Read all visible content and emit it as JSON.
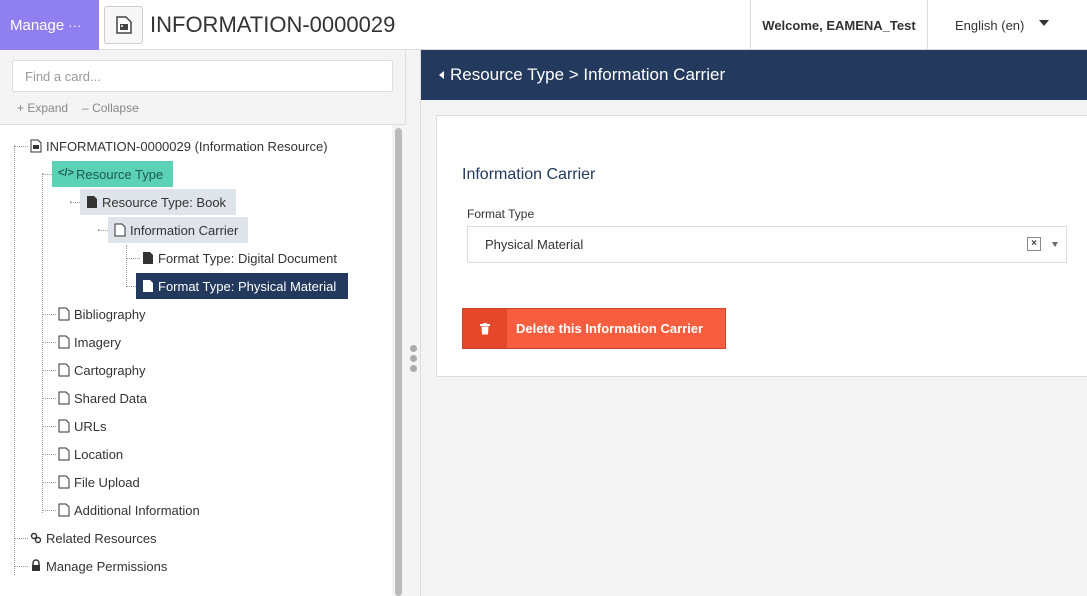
{
  "topbar": {
    "manage_label": "Manage",
    "manage_dots": "···",
    "resource_title": "INFORMATION-0000029",
    "welcome": "Welcome, EAMENA_Test",
    "language": "English (en)"
  },
  "left": {
    "search_placeholder": "Find a card...",
    "expand_label": "Expand",
    "collapse_label": "Collapse"
  },
  "tree": {
    "root": "INFORMATION-0000029 (Information Resource)",
    "resource_type": "Resource Type",
    "resource_type_book": "Resource Type: Book",
    "information_carrier": "Information Carrier",
    "format_digital": "Format Type: Digital Document",
    "format_physical": "Format Type: Physical Material",
    "bibliography": "Bibliography",
    "imagery": "Imagery",
    "cartography": "Cartography",
    "shared_data": "Shared Data",
    "urls": "URLs",
    "location": "Location",
    "file_upload": "File Upload",
    "additional_information": "Additional Information",
    "related_resources": "Related Resources",
    "manage_permissions": "Manage Permissions"
  },
  "card": {
    "breadcrumb": "Resource Type > Information Carrier",
    "title": "Information Carrier",
    "field_label": "Format Type",
    "field_value": "Physical Material",
    "delete_label": "Delete this Information Carrier"
  },
  "colors": {
    "manage_bg": "#8f7ff0",
    "header_bg": "#23395d",
    "selected_green": "#5bd1b6",
    "delete_red": "#f75d3f"
  }
}
